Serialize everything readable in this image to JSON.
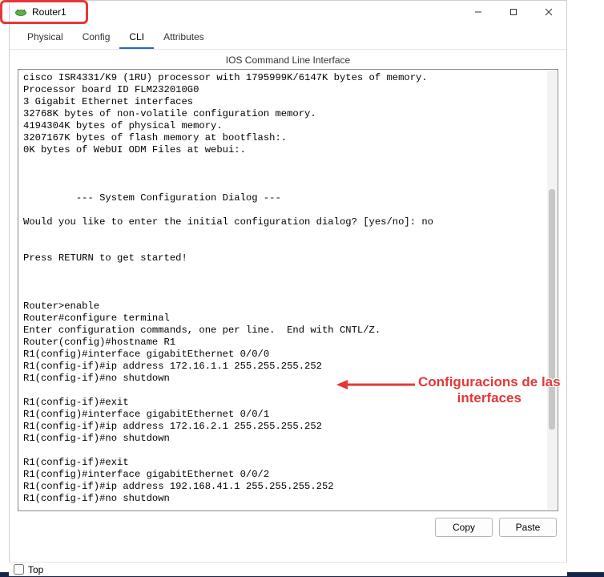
{
  "window": {
    "title": "Router1"
  },
  "tabs": {
    "physical": "Physical",
    "config": "Config",
    "cli": "CLI",
    "attributes": "Attributes"
  },
  "panel_title": "IOS Command Line Interface",
  "terminal_text": "cisco ISR4331/K9 (1RU) processor with 1795999K/6147K bytes of memory.\nProcessor board ID FLM232010G0\n3 Gigabit Ethernet interfaces\n32768K bytes of non-volatile configuration memory.\n4194304K bytes of physical memory.\n3207167K bytes of flash memory at bootflash:.\n0K bytes of WebUI ODM Files at webui:.\n\n\n\n         --- System Configuration Dialog ---\n\nWould you like to enter the initial configuration dialog? [yes/no]: no\n\n\nPress RETURN to get started!\n\n\n\nRouter>enable\nRouter#configure terminal\nEnter configuration commands, one per line.  End with CNTL/Z.\nRouter(config)#hostname R1\nR1(config)#interface gigabitEthernet 0/0/0\nR1(config-if)#ip address 172.16.1.1 255.255.255.252\nR1(config-if)#no shutdown\n\nR1(config-if)#exit\nR1(config)#interface gigabitEthernet 0/0/1\nR1(config-if)#ip address 172.16.2.1 255.255.255.252\nR1(config-if)#no shutdown\n\nR1(config-if)#exit\nR1(config)#interface gigabitEthernet 0/0/2\nR1(config-if)#ip address 192.168.41.1 255.255.255.252\nR1(config-if)#no shutdown",
  "buttons": {
    "copy": "Copy",
    "paste": "Paste"
  },
  "bottom": {
    "top_label": "Top"
  },
  "annotation": {
    "text_line1": "Configuracions de las",
    "text_line2": "interfaces"
  }
}
